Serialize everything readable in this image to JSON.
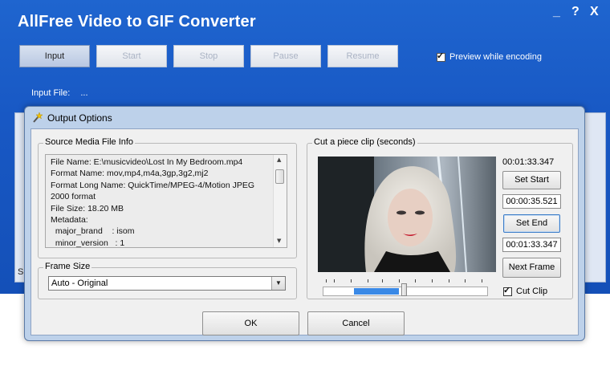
{
  "app": {
    "title": "AllFree Video to GIF Converter",
    "window_controls": {
      "minimize": "_",
      "help": "?",
      "close": "X"
    },
    "toolbar": {
      "input": "Input",
      "start": "Start",
      "stop": "Stop",
      "pause": "Pause",
      "resume": "Resume"
    },
    "preview_label": "Preview while encoding",
    "preview_checked": true,
    "input_file_label": "Input File:",
    "input_file_value": "...",
    "behind_label": "S"
  },
  "dialog": {
    "title": "Output Options",
    "source_group_label": "Source Media File Info",
    "source_info_lines": [
      "File Name: E:\\musicvideo\\Lost In My Bedroom.mp4",
      "Format Name: mov,mp4,m4a,3gp,3g2,mj2",
      "Format Long Name: QuickTime/MPEG-4/Motion JPEG",
      "2000 format",
      "File Size: 18.20 MB",
      "Metadata:",
      "  major_brand    : isom",
      "  minor_version   : 1"
    ],
    "frame_size_label": "Frame Size",
    "frame_size_value": "Auto - Original",
    "clip_group_label": "Cut a piece clip (seconds)",
    "duration": "00:01:33.347",
    "set_start_label": "Set Start",
    "start_value": "00:00:35.521",
    "set_end_label": "Set End",
    "end_value": "00:01:33.347",
    "next_frame_label": "Next Frame",
    "cut_clip_label": "Cut Clip",
    "cut_clip_checked": true,
    "clip_range": {
      "start_fraction": 0.19,
      "end_fraction": 0.46,
      "cursor_fraction": 0.49
    },
    "ok_label": "OK",
    "cancel_label": "Cancel"
  },
  "colors": {
    "app_blue": "#1858c4",
    "dialog_frame": "#bdd1ea",
    "range_blue": "#3a89e6"
  }
}
